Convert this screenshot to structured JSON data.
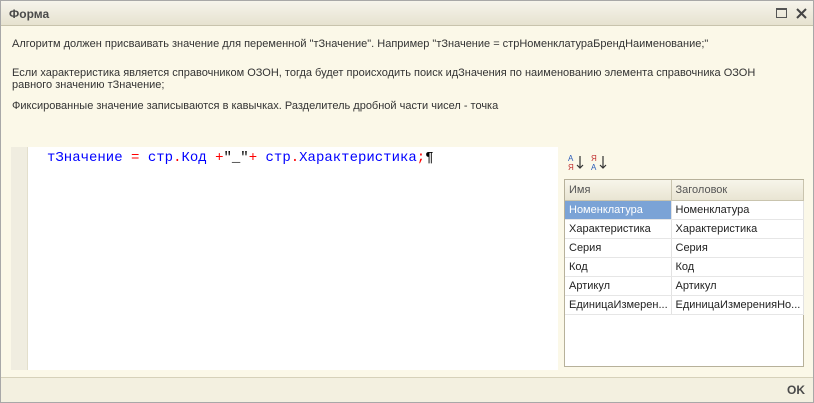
{
  "window": {
    "title": "Форма"
  },
  "info": {
    "line1": "Алгоритм должен присваивать значение для переменной \"тЗначение\". Например \"тЗначение = стрНоменклатураБрендНаименование;\"",
    "line2a": "Если характеристика является справочником ОЗОН, тогда будет происходить поиск идЗначения по наименованию элемента справочника ОЗОН",
    "line2b": "равного значению тЗначение;",
    "line3": "Фиксированные значение записываются в кавычках. Разделитель дробной части чисел - точка"
  },
  "editor": {
    "tokens": {
      "var": "тЗначение",
      "eq": " = ",
      "ref1": "стр",
      "dot1": ".",
      "field1": "Код",
      "plus1": " +",
      "str": "\"_\"",
      "plus2": "+ ",
      "ref2": "стр",
      "dot2": ".",
      "field2": "Характеристика",
      "semi": ";",
      "para": "¶"
    }
  },
  "sort": {
    "asc_icon": "sort-ascending-icon",
    "desc_icon": "sort-descending-icon"
  },
  "grid": {
    "headers": {
      "name": "Имя",
      "title": "Заголовок"
    },
    "rows": [
      {
        "name": "Номенклатура",
        "title": "Номенклатура"
      },
      {
        "name": "Характеристика",
        "title": "Характеристика"
      },
      {
        "name": "Серия",
        "title": "Серия"
      },
      {
        "name": "Код",
        "title": "Код"
      },
      {
        "name": "Артикул",
        "title": "Артикул"
      },
      {
        "name": "ЕдиницаИзмерен...",
        "title": "ЕдиницаИзмеренияНо..."
      }
    ],
    "selected_row": 0,
    "selection_color": "#7ba3d6"
  },
  "footer": {
    "ok_label": "OK"
  }
}
